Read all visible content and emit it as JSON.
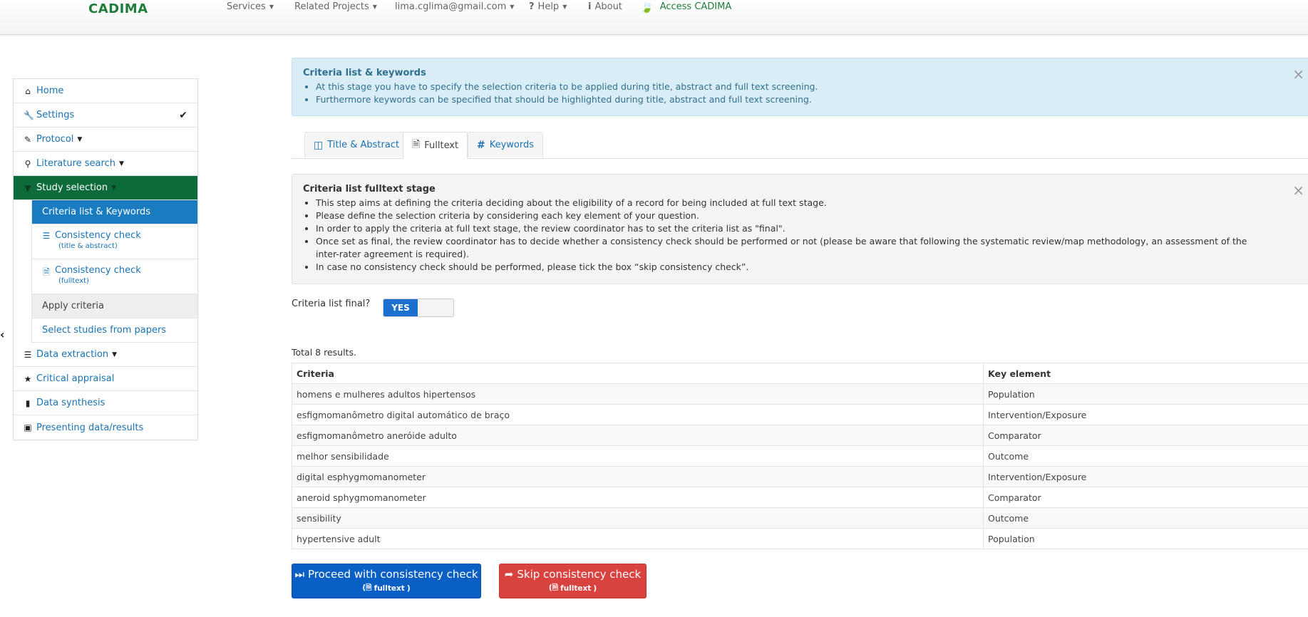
{
  "navbar": {
    "brand": "CADIMA",
    "items": [
      {
        "label": "Services",
        "icon": "",
        "caret": true
      },
      {
        "label": "Related Projects",
        "icon": "",
        "caret": true
      },
      {
        "label": "lima.cglima@gmail.com",
        "icon": "",
        "caret": true
      },
      {
        "label": "Help",
        "icon": "?",
        "caret": true
      },
      {
        "label": "About",
        "icon": "i",
        "caret": false
      }
    ],
    "access_label": "Access CADIMA"
  },
  "sidebar": {
    "items": [
      {
        "label": "Home",
        "icon": "home-icon"
      },
      {
        "label": "Settings",
        "icon": "wrench-icon"
      },
      {
        "label": "Protocol",
        "icon": "pencil-icon"
      },
      {
        "label": "Literature search",
        "icon": "search-icon"
      },
      {
        "label": "Study selection",
        "icon": "filter-icon"
      },
      {
        "label": "Criteria list & Keywords"
      },
      {
        "label": "Consistency check",
        "sublabel": "(title & abstract)",
        "icon": "list-icon"
      },
      {
        "label": "Consistency check",
        "sublabel": "(fulltext)",
        "icon": "document-icon"
      },
      {
        "label": "Apply criteria"
      },
      {
        "label": "Select studies from papers"
      },
      {
        "label": "Data extraction",
        "icon": "list-icon"
      },
      {
        "label": "Critical appraisal",
        "icon": "star-icon"
      },
      {
        "label": "Data synthesis",
        "icon": "file-icon"
      },
      {
        "label": "Presenting data/results",
        "icon": "picture-icon"
      }
    ]
  },
  "info_alert": {
    "title": "Criteria list & keywords",
    "lines": [
      "At this stage you have to specify the selection criteria to be applied during title, abstract and full text screening.",
      "Furthermore keywords can be specified that should be highlighted during title, abstract and full text screening."
    ]
  },
  "tabs": [
    {
      "label": "Title & Abstract",
      "icon": "columns-icon"
    },
    {
      "label": "Fulltext",
      "icon": "document-icon"
    },
    {
      "label": "Keywords",
      "icon": "hashtag-icon"
    }
  ],
  "stage_alert": {
    "title": "Criteria list fulltext stage",
    "lines": [
      "This step aims at defining the criteria deciding about the eligibility of a record for being included at full text stage.",
      "Please define the selection criteria by considering each key element of your question.",
      "In order to apply the criteria at full text stage, the review coordinator has to set the criteria list as \"final\".",
      "Once set as final, the review coordinator has to decide whether a consistency check should be performed or not (please be aware that following the systematic review/map methodology, an assessment of the inter-rater agreement is required).",
      "In case no consistency check should be performed, please tick the box “skip consistency check”."
    ]
  },
  "final_toggle": {
    "label": "Criteria list final?",
    "value": "YES"
  },
  "results": {
    "total_label": "Total 8 results.",
    "columns": [
      "Criteria",
      "Key element"
    ],
    "rows": [
      [
        "homens e mulheres adultos hipertensos",
        "Population"
      ],
      [
        "esfigmomanômetro digital automático de braço",
        "Intervention/Exposure"
      ],
      [
        "esfigmomanômetro aneróide adulto",
        "Comparator"
      ],
      [
        "melhor sensibilidade",
        "Outcome"
      ],
      [
        "digital esphygmomanometer",
        "Intervention/Exposure"
      ],
      [
        "aneroid sphygmomanometer",
        "Comparator"
      ],
      [
        "sensibility",
        "Outcome"
      ],
      [
        "hypertensive adult",
        "Population"
      ]
    ]
  },
  "buttons": {
    "proceed": {
      "label": "Proceed with consistency check",
      "sub": "fulltext"
    },
    "skip": {
      "label": "Skip consistency check",
      "sub": "fulltext"
    }
  },
  "colors": {
    "brand_green": "#1e7d3a",
    "active_green": "#0d6a3b",
    "active_blue": "#1a7cc0",
    "proceed_blue": "#0a5fc4",
    "skip_red": "#d9433f"
  }
}
